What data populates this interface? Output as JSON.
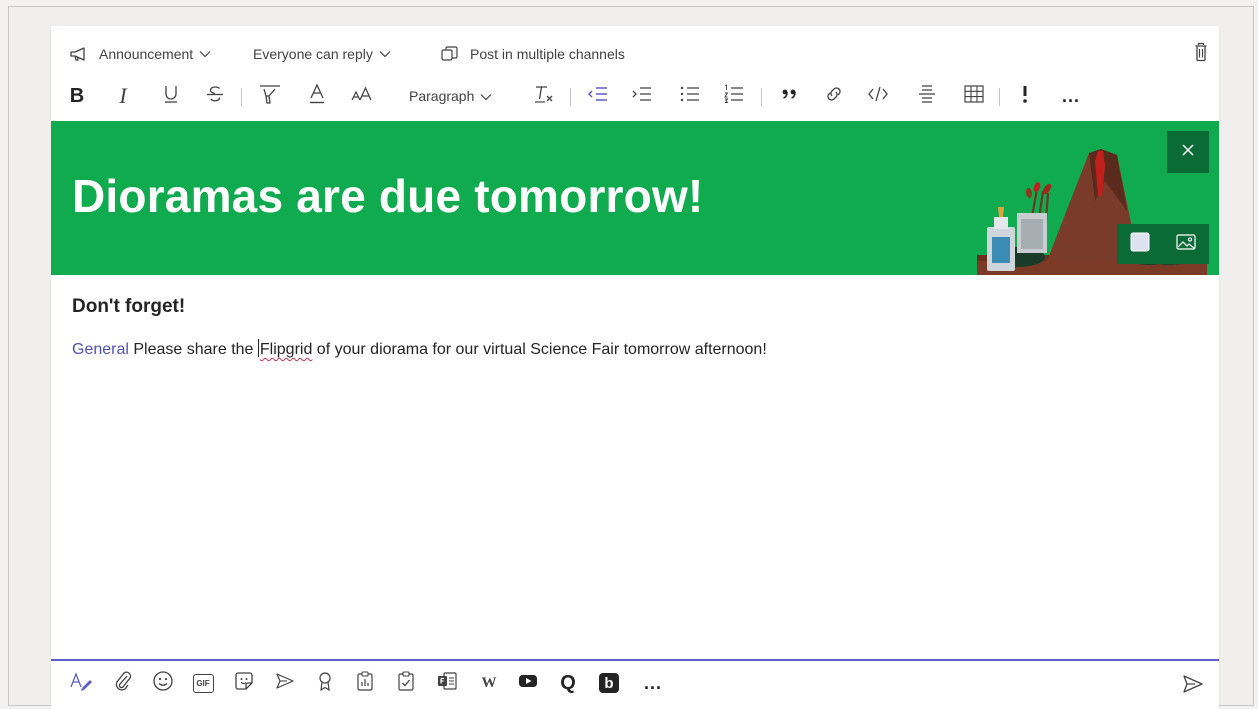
{
  "compose": {
    "post_type_label": "Announcement",
    "reply_label": "Everyone can reply",
    "multi_channel_label": "Post in multiple channels"
  },
  "format_toolbar": {
    "bold": "B",
    "italic": "I",
    "paragraph_label": "Paragraph",
    "more": "..."
  },
  "banner": {
    "headline": "Dioramas are due tomorrow!",
    "background_color": "#0fab4e"
  },
  "message": {
    "subject": "Don't forget!",
    "mention": "General",
    "text_before": " Please share the ",
    "misspelled_word": "Flipgrid",
    "text_after": " of your diorama for our virtual Science Fair tomorrow afternoon!"
  },
  "bottom_toolbar": {
    "gif_label": "GIF",
    "wiki_label": "W",
    "q_label": "Q",
    "b_label": "b",
    "more": "..."
  },
  "colors": {
    "accent": "#5b5fc7",
    "mention": "#4f52b2",
    "format_active": "#5b5fc7"
  }
}
